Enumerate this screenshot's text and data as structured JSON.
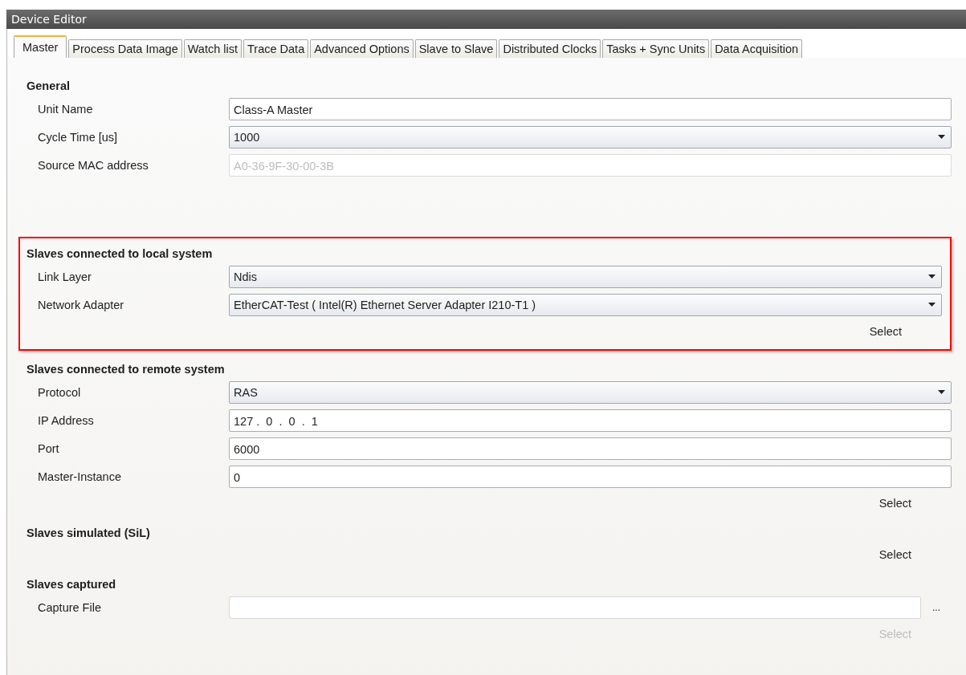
{
  "window": {
    "title": "Device Editor"
  },
  "tabs": [
    {
      "label": "Master",
      "selected": true
    },
    {
      "label": "Process Data Image",
      "selected": false
    },
    {
      "label": "Watch list",
      "selected": false
    },
    {
      "label": "Trace Data",
      "selected": false
    },
    {
      "label": "Advanced Options",
      "selected": false
    },
    {
      "label": "Slave to Slave",
      "selected": false
    },
    {
      "label": "Distributed Clocks",
      "selected": false
    },
    {
      "label": "Tasks + Sync Units",
      "selected": false
    },
    {
      "label": "Data Acquisition",
      "selected": false
    }
  ],
  "sections": [
    {
      "heading": "General",
      "highlighted": false,
      "rows": [
        {
          "label": "Unit Name",
          "kind": "text",
          "value": "Class-A Master",
          "disabled": false
        },
        {
          "label": "Cycle Time [us]",
          "kind": "combo",
          "value": "1000",
          "disabled": false
        },
        {
          "label": "Source MAC address",
          "kind": "text",
          "value": "A0-36-9F-30-00-3B",
          "disabled": true
        }
      ]
    },
    {
      "heading": "Slaves connected to local system",
      "highlighted": true,
      "rows": [
        {
          "label": "Link Layer",
          "kind": "combo",
          "value": "Ndis",
          "disabled": false
        },
        {
          "label": "Network Adapter",
          "kind": "combo",
          "value": "EtherCAT-Test ( Intel(R) Ethernet Server Adapter I210-T1 )",
          "disabled": false
        }
      ],
      "select": {
        "label": "Select",
        "disabled": false
      }
    },
    {
      "heading": "Slaves connected to remote system",
      "highlighted": false,
      "rows": [
        {
          "label": "Protocol",
          "kind": "combo",
          "value": "RAS",
          "disabled": false
        },
        {
          "label": "IP Address",
          "kind": "ip",
          "value": "127 .  0  .  0  .  1",
          "disabled": false
        },
        {
          "label": "Port",
          "kind": "text",
          "value": "6000",
          "disabled": false
        },
        {
          "label": "Master-Instance",
          "kind": "text",
          "value": "0",
          "disabled": false
        }
      ],
      "select": {
        "label": "Select",
        "disabled": false
      }
    },
    {
      "heading": "Slaves simulated (SiL)",
      "highlighted": false,
      "select": {
        "label": "Select",
        "disabled": false
      }
    },
    {
      "heading": "Slaves captured",
      "highlighted": false,
      "rows": [
        {
          "label": "Capture File",
          "kind": "file",
          "browse": "...",
          "disabled": false
        }
      ],
      "select": {
        "label": "Select",
        "disabled": true
      }
    }
  ]
}
